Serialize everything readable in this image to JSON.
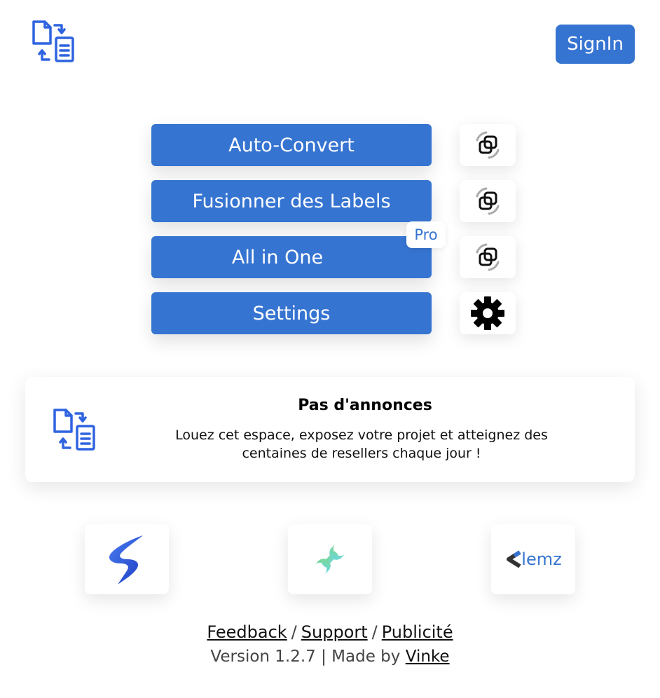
{
  "header": {
    "signin_label": "SignIn"
  },
  "menu": {
    "buttons": [
      {
        "label": "Auto-Convert",
        "side_icon": "sync-copy-icon"
      },
      {
        "label": "Fusionner des Labels",
        "side_icon": "sync-copy-icon"
      },
      {
        "label": "All in One",
        "side_icon": "sync-copy-icon",
        "badge": "Pro"
      },
      {
        "label": "Settings",
        "side_icon": "gear-icon"
      }
    ]
  },
  "ad": {
    "title": "Pas d'annonces",
    "text": "Louez cet espace, exposez votre projet et atteignez des centaines de resellers chaque jour !"
  },
  "partners": [
    {
      "icon": "blue-s-logo-icon"
    },
    {
      "icon": "wrench-icon"
    },
    {
      "icon": "clemz-logo-icon",
      "text": "lemz"
    }
  ],
  "footer": {
    "links": [
      "Feedback",
      "Support",
      "Publicité"
    ],
    "separator": "/",
    "version_prefix": "Version 1.2.7 | Made by",
    "author": "Vinke"
  },
  "colors": {
    "accent": "#3674d1",
    "logo_blue": "#2f63e0"
  }
}
